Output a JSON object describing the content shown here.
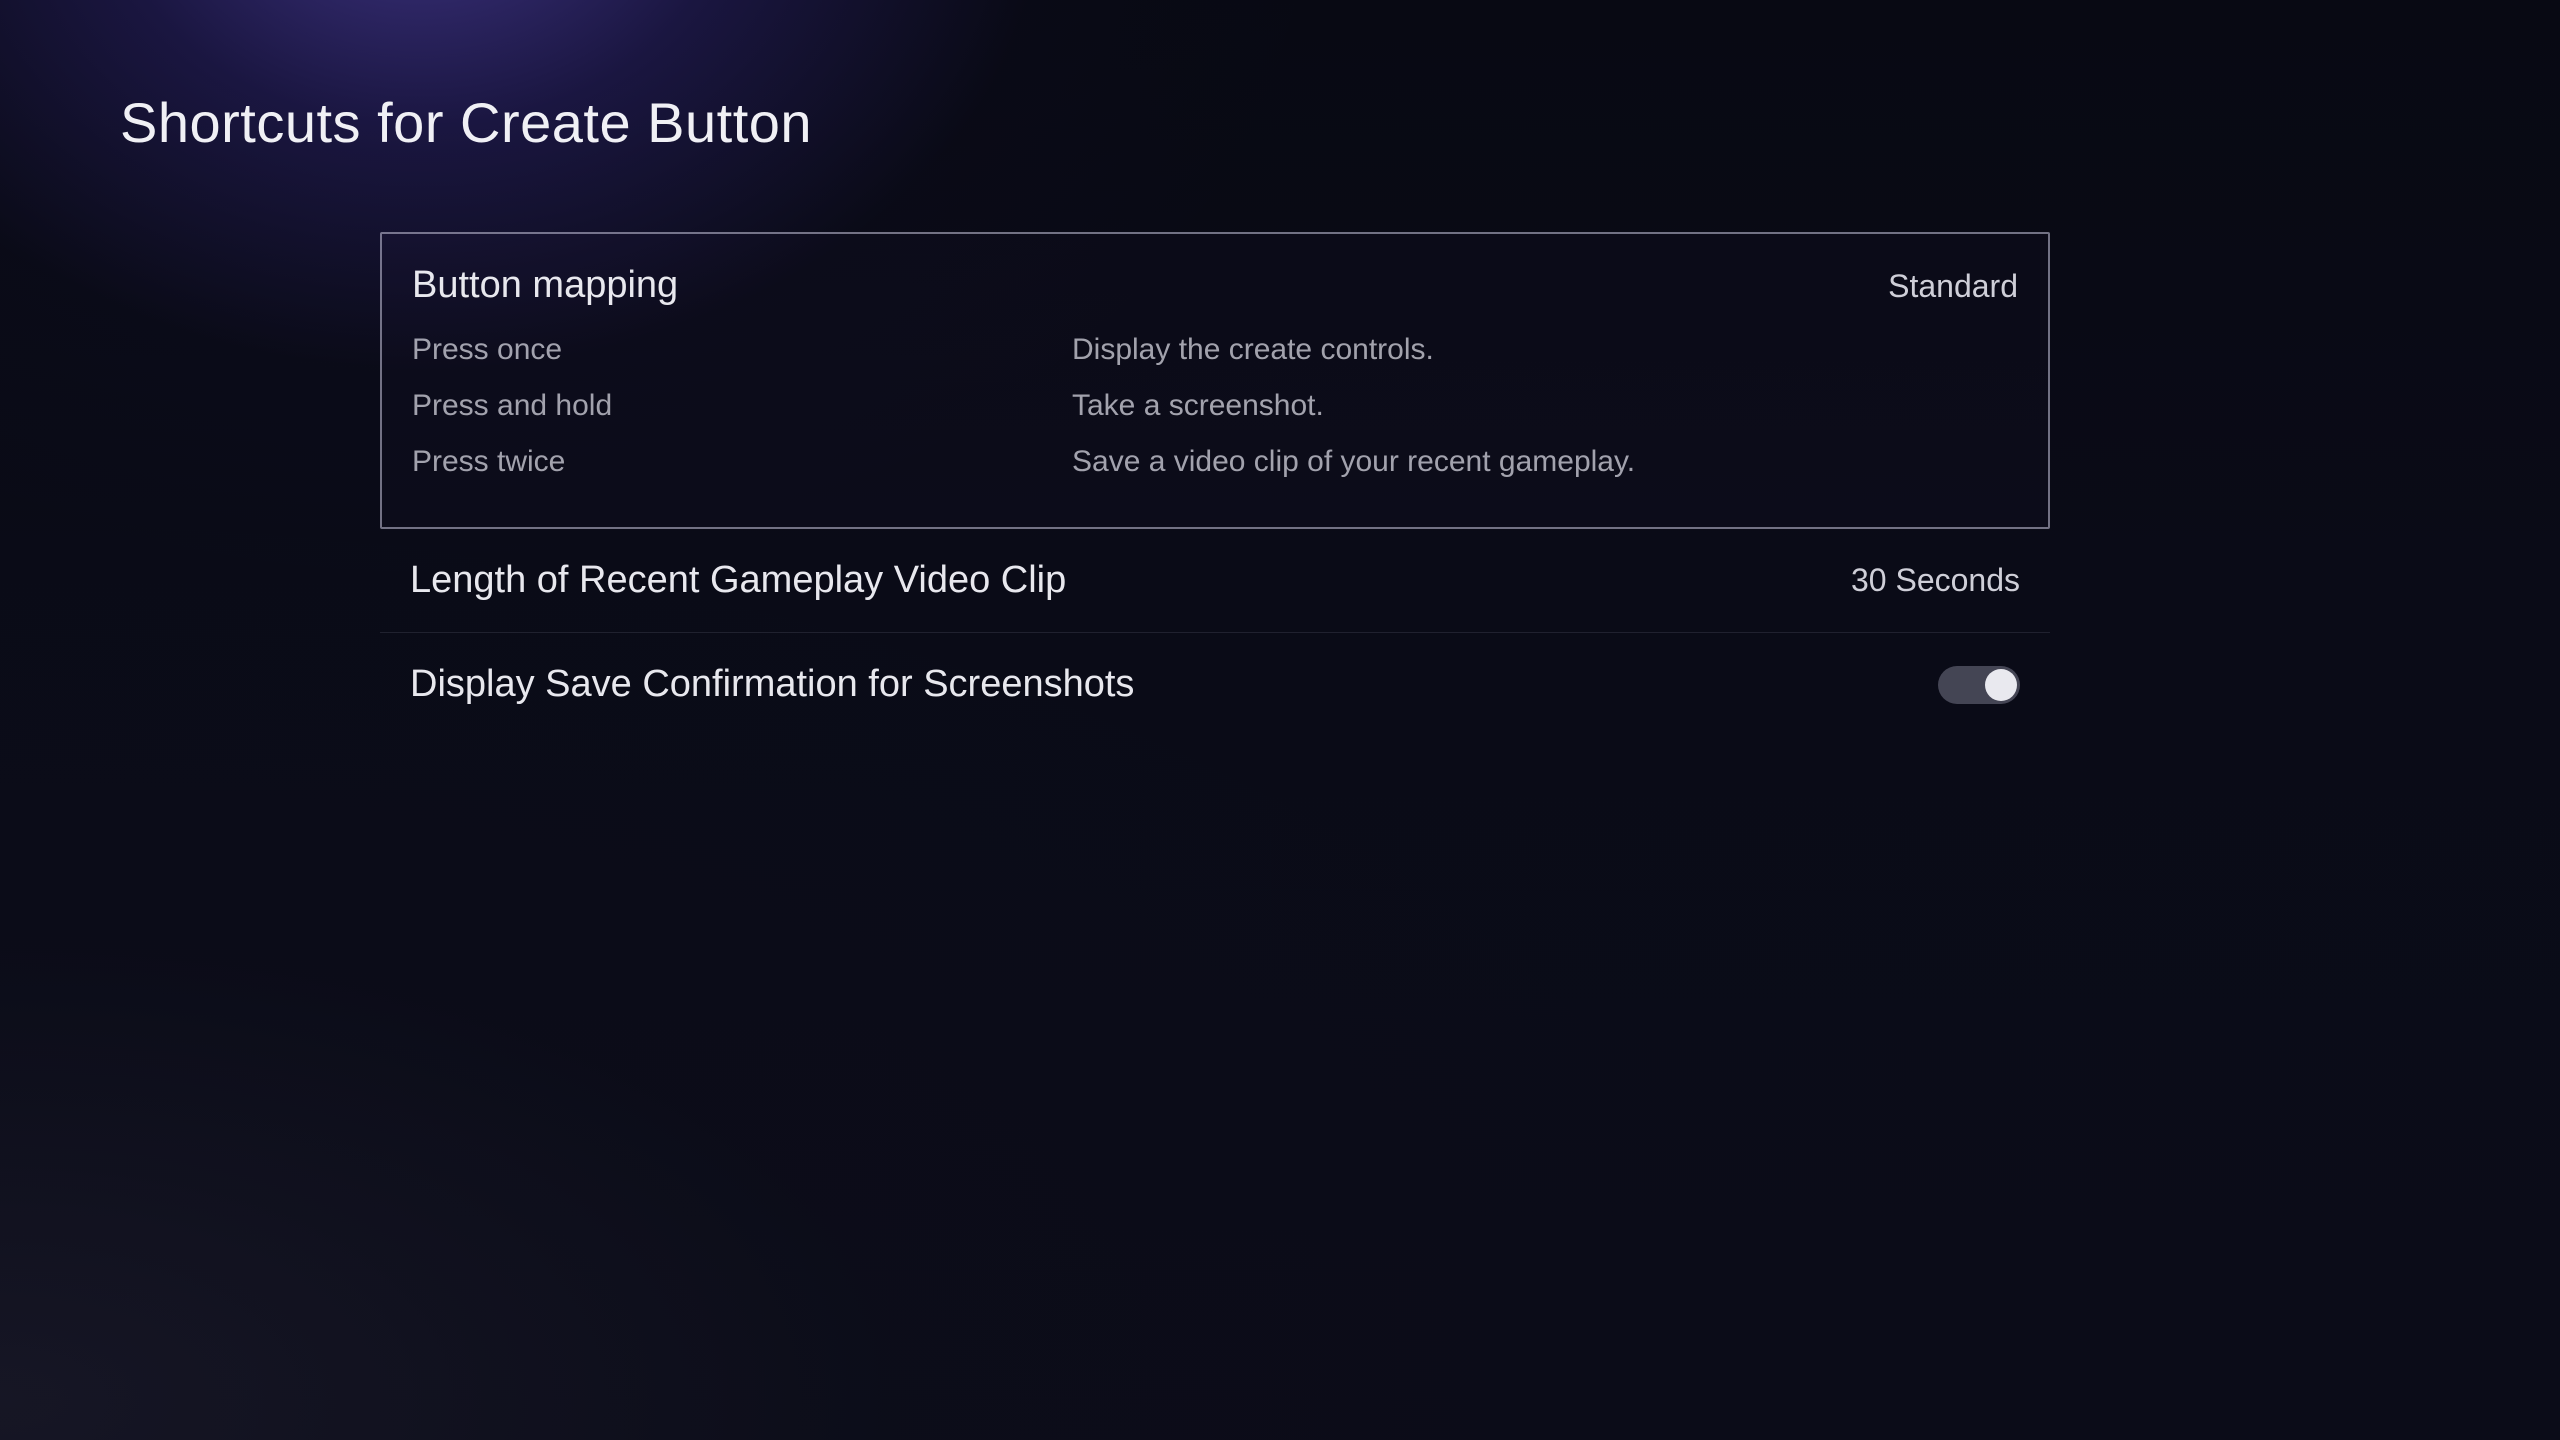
{
  "page": {
    "title": "Shortcuts for Create Button"
  },
  "settings": {
    "button_mapping": {
      "label": "Button mapping",
      "value": "Standard",
      "rows": [
        {
          "action": "Press once",
          "result": "Display the create controls."
        },
        {
          "action": "Press and hold",
          "result": "Take a screenshot."
        },
        {
          "action": "Press twice",
          "result": "Save a video clip of your recent gameplay."
        }
      ]
    },
    "clip_length": {
      "label": "Length of Recent Gameplay Video Clip",
      "value": "30 Seconds"
    },
    "save_confirmation": {
      "label": "Display Save Confirmation for Screenshots",
      "enabled": false
    }
  }
}
